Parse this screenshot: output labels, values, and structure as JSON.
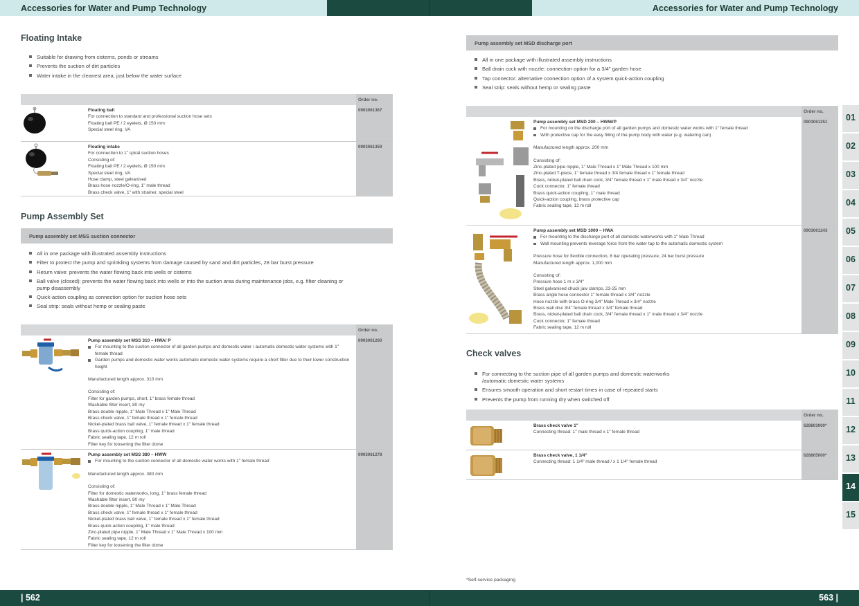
{
  "header": {
    "left_title": "Accessories for Water and Pump Technology",
    "right_title": "Accessories for Water and Pump Technology"
  },
  "footer": {
    "left_page": "| 562",
    "right_page": "563 |",
    "footnote": "*Self-service packaging"
  },
  "order_header": "Order no.",
  "floating": {
    "title": "Floating Intake",
    "bullets": [
      "Suitable for drawing from cisterns, ponds or streams",
      "Prevents the suction of dirt particles",
      "Water intake in the cleanest area, just below the water surface"
    ],
    "rows": [
      {
        "title": "Floating ball",
        "order": "0903061367",
        "lines": [
          "For connection to standard and professional suction hose sets",
          "Floating ball PE / 2 eyelets, Ø 150 mm",
          "Special steel ring, VA"
        ]
      },
      {
        "title": "Floating intake",
        "order": "0903061359",
        "lines": [
          "For connection to 1\" spiral suction hoses",
          "Consisting of:",
          "Floating ball PE / 2 eyelets, Ø 150 mm",
          "Special steel ring, VA",
          "Hose clamp, steel galvanised",
          "Brass hose nozzle/O-ring, 1\" male thread",
          "Brass check valve, 1\" with strainer, special steel"
        ]
      }
    ]
  },
  "pump_assembly": {
    "title": "Pump Assembly Set",
    "band": "Pump assembly set MSS suction connector",
    "bullets": [
      "All in one package with illustrated assembly instructions",
      "Filter to protect the pump and sprinkling systems from damage caused by sand and dirt particles, 28 bar burst pressure",
      "Return valve: prevents the water flowing back into wells or cisterns",
      "Ball valve (closed): prevents the water flowing back into wells or into the suction area during maintenance jobs, e.g. filter cleaning or pump disassembly",
      "Quick-action coupling as connection option for suction hose sets",
      "Seal strip: seals without hemp or sealing paste"
    ],
    "rows": [
      {
        "title": "Pump assembly set MSS 310 – HWA/ P",
        "order": "0903061260",
        "bullets": [
          "For mounting to the suction connector of all garden pumps and domestic water / automatic domestic water systems with 1\" female thread",
          "Garden pumps and domestic water works automatic domestic water systems require a short filter due to their lower construction height"
        ],
        "length": "Manufactured length approx. 310 mm",
        "consisting": [
          "Consisting of:",
          "Filter for garden pumps, short, 1\" brass female thread",
          "Washable filter insert, 80 my",
          "Brass double nipple, 1\" Male Thread x 1\" Male Thread",
          "Brass check valve, 1\" female thread x 1\" female thread",
          "Nickel-plated brass ball valve, 1\" female thread x 1\" female thread",
          "Brass quick-action coupling, 1\" male thread",
          "Fabric sealing tape, 12 m roll",
          "Filter key for loosening the filter dome"
        ]
      },
      {
        "title": "Pump assembly set MSS 380 – HWW",
        "order": "0903061278",
        "bullets": [
          "For mounting to the suction connector of all domestic water works with 1\" female thread"
        ],
        "length": "Manufactured length approx. 380 mm",
        "consisting": [
          "Consisting of:",
          "Filter for domestic waterworks, long, 1\" brass female thread",
          "Washable filter insert, 80 my",
          "Brass double nipple, 1\" Male Thread x 1\" Male Thread",
          "Brass check valve, 1\" female thread x 1\" female thread",
          "Nickel-plated brass ball valve, 1\" female thread x 1\" female thread",
          "Brass quick-action coupling, 1\" male thread",
          "Zinc-plated pipe nipple, 1\" Male Thread x 1\" Male Thread x 100 mm",
          "Fabric sealing tape, 12 m roll",
          "Filter key for loosening the filter dome"
        ]
      }
    ]
  },
  "msd": {
    "band": "Pump assembly set MSD discharge port",
    "bullets": [
      "All in one package with illustrated assembly instructions",
      "Ball drain cock with nozzle: connection option for a 3/4\" garden hose",
      "Tap connector: alternative connection option of a system quick-action coupling",
      "Seal strip: seals without hemp or sealing paste"
    ],
    "rows": [
      {
        "title": "Pump assembly set MSD 200 – HWW/P",
        "order": "0903061251",
        "bullets": [
          "For mounting on the discharge port of all garden pumps and domestic water works with 1\" female thread",
          "With protective cap for the easy filling of the pump body with water (e.g. watering can)"
        ],
        "length": "Manufactured length approx. 200 mm",
        "consisting": [
          "Consisting of:",
          "Zinc-plated pipe nipple, 1\" Male Thread x 1\" Male Thread x 100 mm",
          "Zinc-plated T-piece, 1\" female thread x 3/4 female thread x 1\" female thread",
          "Brass, nickel-plated ball drain cock, 3/4\" female thread x 1\" male thread x 3/4\" nozzle",
          "Cock connector, 1\" female thread",
          "Brass quick-action coupling, 1\" male thread",
          "Quick-action coupling, brass protective cap",
          "Fabric sealing tape, 12 m roll"
        ]
      },
      {
        "title": "Pump assembly set MSD 1000 – HWA",
        "order": "0903061243",
        "bullets": [
          "For mounting to the discharge port of all domestic waterworks with 1\" Male Thread",
          "Wall mounting prevents leverage force from the water tap to the automatic domestic system"
        ],
        "extra": [
          "Pressure hose for flexible connection, 8 bar operating pressure, 24 bar burst pressure",
          "Manufactured length approx. 1,000 mm"
        ],
        "consisting": [
          "Consisting of:",
          "Pressure hose 1 m x 3/4\"",
          "Steel galvanised chuck jaw clamps, 23-25 mm",
          "Brass angle hose connector 1\" female thread x 3/4\" nozzle",
          "Hose nozzle with brass O-ring 3/4\" Male Thread x 3/4\" nozzle",
          "Brass wall disc 3/4\" female thread x 3/4\" female thread",
          "Brass, nickel-plated ball drain cock, 3/4\" female thread x 1\" male thread x 3/4\" nozzle",
          "Cock connector, 1\" female thread",
          "Fabric sealing tape, 12 m roll"
        ]
      }
    ]
  },
  "check_valves": {
    "title": "Check valves",
    "bullets": [
      "For connecting to the suction pipe of all garden pumps and domestic waterworks /automatic domestic water systems",
      "Ensures smooth operation and short restart times in case of repeated starts",
      "Prevents the pump from running dry when switched off"
    ],
    "rows": [
      {
        "title": "Brass check valve 1\"",
        "order": "628803000*",
        "lines": [
          "Connecting thread: 1\" male thread x 1\" female thread"
        ]
      },
      {
        "title": "Brass check valve, 1 1/4\"",
        "order": "628805000*",
        "lines": [
          "Connecting thread: 1 1/4\" male thread / x 1 1/4\" female thread"
        ]
      }
    ]
  },
  "tabs": {
    "items": [
      "01",
      "02",
      "03",
      "04",
      "05",
      "06",
      "07",
      "08",
      "09",
      "10",
      "11",
      "12",
      "13",
      "14",
      "15"
    ],
    "active": "14"
  }
}
